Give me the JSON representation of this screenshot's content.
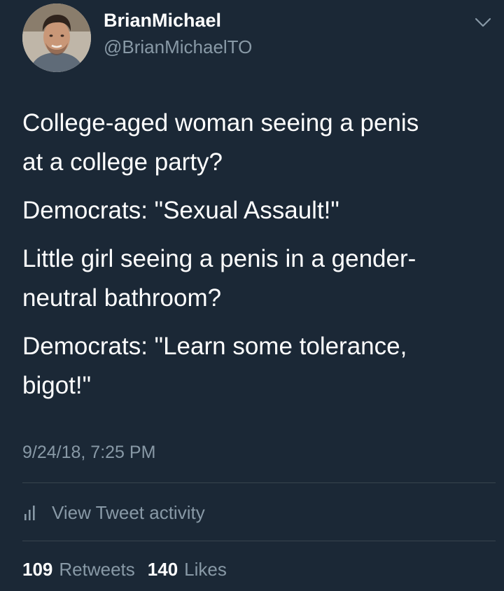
{
  "author": {
    "name": "BrianMichael",
    "handle": "@BrianMichaelTO"
  },
  "tweet": {
    "lines": [
      "College-aged woman seeing a penis",
      "at a college party?",
      "Democrats: \"Sexual Assault!\"",
      "Little girl seeing a penis in a gender-",
      "neutral bathroom?",
      "Democrats: \"Learn some tolerance,",
      "bigot!\""
    ],
    "timestamp": "9/24/18, 7:25 PM"
  },
  "activity": {
    "label": "View Tweet activity",
    "icon": "bar-chart-icon"
  },
  "stats": {
    "retweets_count": "109",
    "retweets_label": "Retweets",
    "likes_count": "140",
    "likes_label": "Likes"
  },
  "colors": {
    "background": "#1b2836",
    "primary_text": "#ffffff",
    "secondary_text": "#8899a6",
    "divider": "#38444d"
  }
}
